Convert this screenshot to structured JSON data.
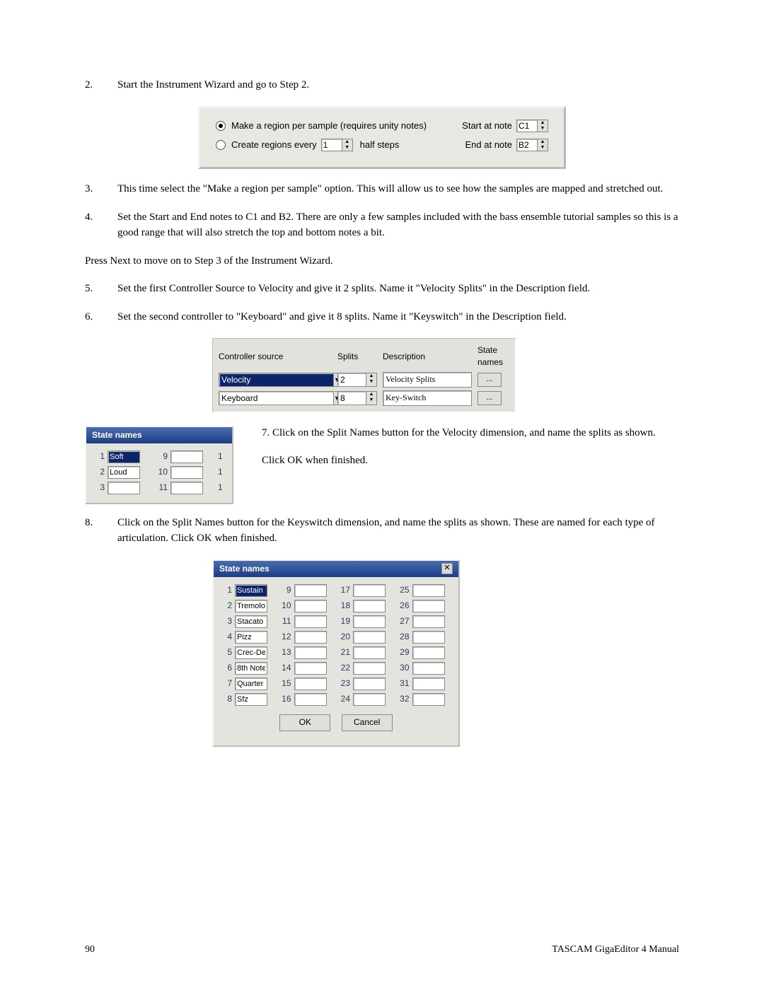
{
  "steps": {
    "s2": "Start the Instrument Wizard and go to Step 2.",
    "s3": "This time select the \"Make a region per sample\" option.  This will allow us to see how the samples are mapped and stretched out.",
    "s4": "Set the Start and End notes to C1 and B2. There are only a few samples included with the bass ensemble tutorial samples so this is a good range that will also stretch the top and bottom notes a bit.",
    "press_next": "Press Next to move on to Step 3 of the Instrument Wizard.",
    "s5": "Set the first Controller Source to Velocity and give it 2 splits. Name it \"Velocity Splits\" in the Description field.",
    "s6": "Set the second controller to \"Keyboard\" and give it 8 splits. Name it \"Keyswitch\" in the Description field.",
    "s7": "7. Click on the Split Names button for the Velocity dimension, and name the splits as shown.",
    "s7b": "Click OK when finished.",
    "s8": "Click on the Split Names button for the Keyswitch dimension, and name the splits as shown. These are named for each type of articulation.  Click OK when finished."
  },
  "nums": {
    "n2": "2.",
    "n3": "3.",
    "n4": "4.",
    "n5": "5.",
    "n6": "6.",
    "n8": "8."
  },
  "panel1": {
    "opt1": "Make a region per sample (requires unity notes)",
    "opt2": "Create regions every",
    "opt2_val": "1",
    "opt2_unit": "half steps",
    "start_label": "Start at note",
    "start_val": "C1",
    "end_label": "End at note",
    "end_val": "B2"
  },
  "panel2": {
    "hdr_src": "Controller source",
    "hdr_splits": "Splits",
    "hdr_desc": "Description",
    "hdr_state": "State names",
    "rows": [
      {
        "src": "Velocity",
        "splits": "2",
        "desc": "Velocity Splits",
        "sel": true
      },
      {
        "src": "Keyboard",
        "splits": "8",
        "desc": "Key-Switch",
        "sel": false
      }
    ],
    "dots": "..."
  },
  "state_small": {
    "title": "State names",
    "cells": [
      {
        "n": "1",
        "v": "Soft",
        "sel": true
      },
      {
        "n": "9",
        "v": ""
      },
      {
        "n": "2",
        "v": "Loud"
      },
      {
        "n": "10",
        "v": ""
      },
      {
        "n": "3",
        "v": ""
      },
      {
        "n": "11",
        "v": ""
      }
    ],
    "tail": [
      "1",
      "1",
      "1"
    ]
  },
  "state_big": {
    "title": "State names",
    "ok": "OK",
    "cancel": "Cancel",
    "col0": [
      {
        "n": "1",
        "v": "Sustain",
        "sel": true
      },
      {
        "n": "2",
        "v": "Tremolo"
      },
      {
        "n": "3",
        "v": "Stacato"
      },
      {
        "n": "4",
        "v": "Pizz"
      },
      {
        "n": "5",
        "v": "Crec-De"
      },
      {
        "n": "6",
        "v": "8th Note"
      },
      {
        "n": "7",
        "v": "Quarter"
      },
      {
        "n": "8",
        "v": "Sfz"
      }
    ],
    "col1": [
      {
        "n": "9",
        "v": ""
      },
      {
        "n": "10",
        "v": ""
      },
      {
        "n": "11",
        "v": ""
      },
      {
        "n": "12",
        "v": ""
      },
      {
        "n": "13",
        "v": ""
      },
      {
        "n": "14",
        "v": ""
      },
      {
        "n": "15",
        "v": ""
      },
      {
        "n": "16",
        "v": ""
      }
    ],
    "col2": [
      {
        "n": "17",
        "v": ""
      },
      {
        "n": "18",
        "v": ""
      },
      {
        "n": "19",
        "v": ""
      },
      {
        "n": "20",
        "v": ""
      },
      {
        "n": "21",
        "v": ""
      },
      {
        "n": "22",
        "v": ""
      },
      {
        "n": "23",
        "v": ""
      },
      {
        "n": "24",
        "v": ""
      }
    ],
    "col3": [
      {
        "n": "25",
        "v": ""
      },
      {
        "n": "26",
        "v": ""
      },
      {
        "n": "27",
        "v": ""
      },
      {
        "n": "28",
        "v": ""
      },
      {
        "n": "29",
        "v": ""
      },
      {
        "n": "30",
        "v": ""
      },
      {
        "n": "31",
        "v": ""
      },
      {
        "n": "32",
        "v": ""
      }
    ]
  },
  "footer": {
    "page": "90",
    "title": "TASCAM GigaEditor 4 Manual"
  },
  "glyph": {
    "up": "▲",
    "down": "▼",
    "close": "✕"
  }
}
